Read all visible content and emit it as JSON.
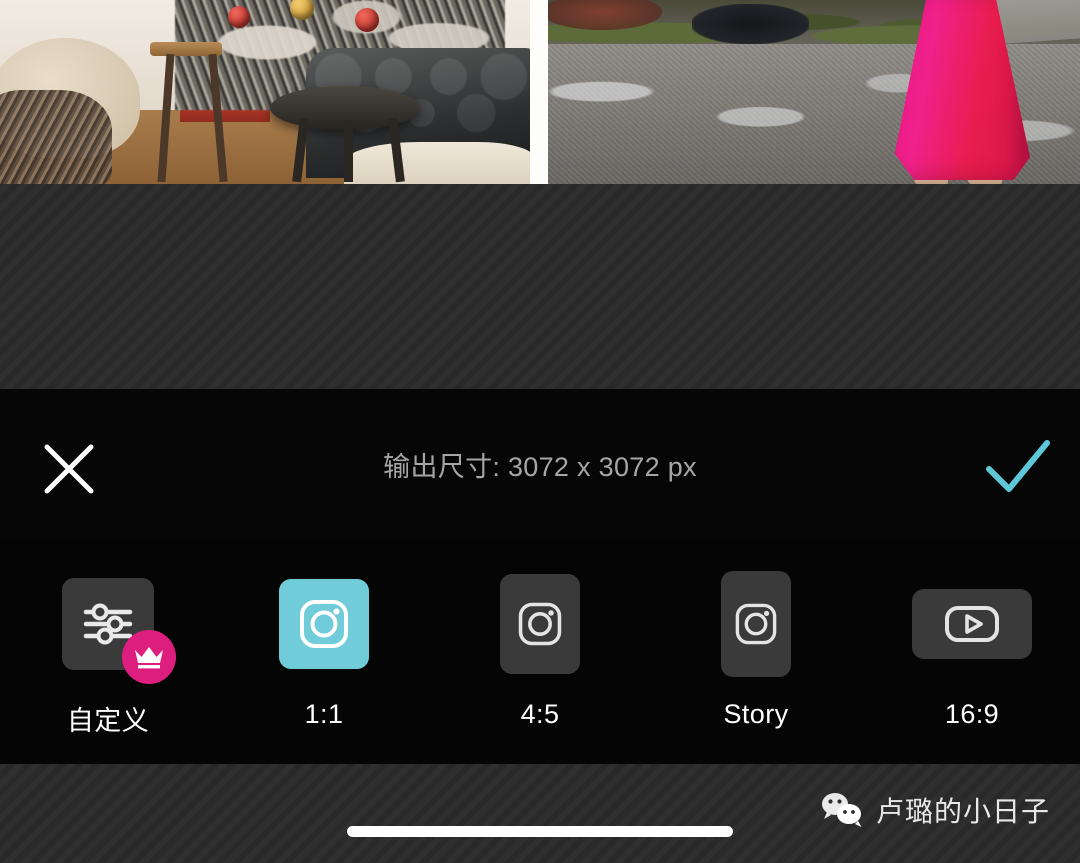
{
  "app": {
    "name": "photo-collage-editor",
    "accent_cyan": "#6fccd8",
    "accent_pink": "#dd1e7f",
    "toolbar_bg": "#060606",
    "canvas_bg": "#2b2b2b"
  },
  "preview": {
    "photos": [
      {
        "name": "christmas-interior-photo",
        "alt": "Golden dog beside a flocked Christmas tree on a black glass side table with a dark tufted leather sofa"
      },
      {
        "name": "pink-skirt-street-photo",
        "alt": "Person in a hot pink midi skirt and nude heels standing on mossy concrete pavement"
      }
    ]
  },
  "toolbar": {
    "close_label": "×",
    "close_icon": "close-x-icon",
    "confirm_icon": "checkmark-icon",
    "confirm_label": "✓",
    "output_size_text": "输出尺寸: 3072 x 3072 px",
    "output_width": "3072",
    "output_height": "3072",
    "output_unit": "px"
  },
  "ratios": {
    "selected": "1:1",
    "items": [
      {
        "label": "自定义",
        "icon": "sliders-icon",
        "shape": "square",
        "premium": true,
        "premium_icon": "crown-icon",
        "selected": false
      },
      {
        "label": "1:1",
        "icon": "instagram-icon",
        "shape": "square",
        "premium": false,
        "selected": true
      },
      {
        "label": "4:5",
        "icon": "instagram-icon",
        "shape": "portrait",
        "premium": false,
        "selected": false
      },
      {
        "label": "Story",
        "icon": "instagram-icon",
        "shape": "tall-portrait",
        "premium": false,
        "selected": false
      },
      {
        "label": "16:9",
        "icon": "youtube-icon",
        "shape": "landscape",
        "premium": false,
        "selected": false
      }
    ]
  },
  "watermark": {
    "icon": "wechat-icon",
    "text": "卢璐的小日子"
  },
  "system": {
    "home_indicator": "home-indicator-bar"
  }
}
